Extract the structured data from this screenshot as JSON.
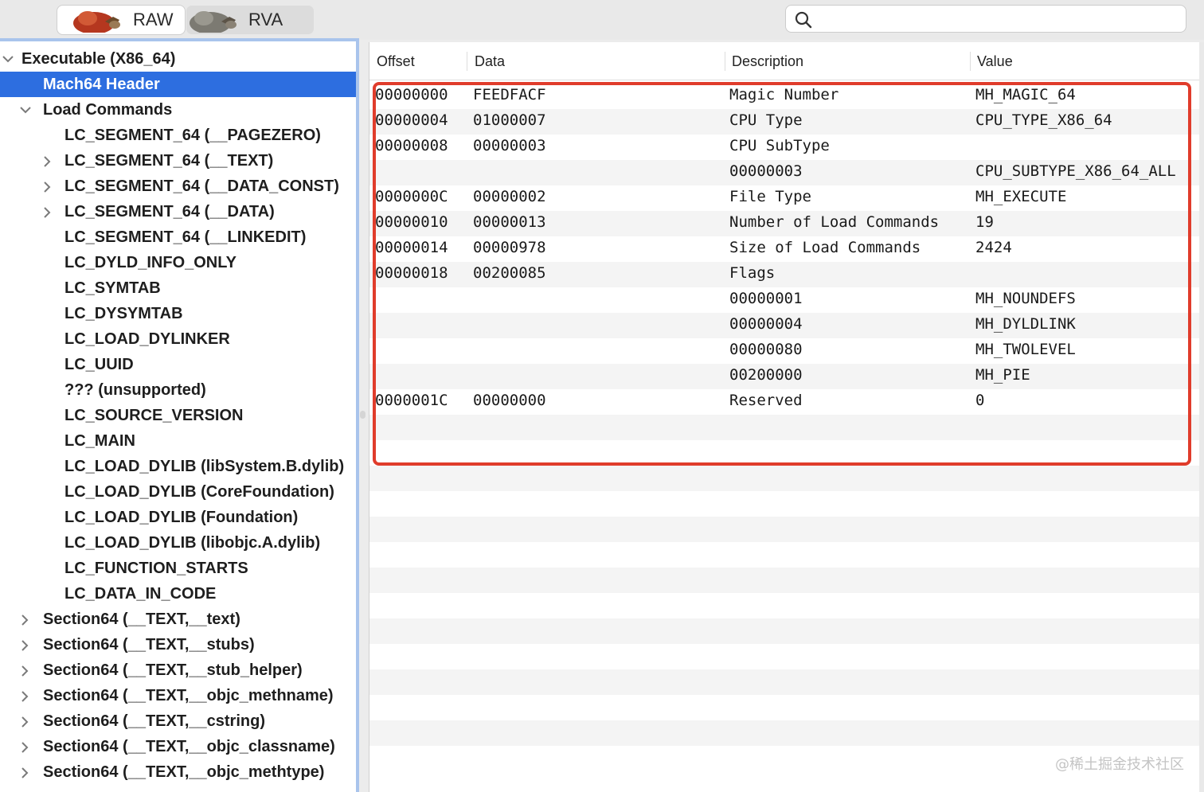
{
  "toolbar": {
    "raw_label": "RAW",
    "rva_label": "RVA",
    "search_placeholder": "",
    "icons": {
      "search": "magnifier-icon"
    }
  },
  "sidebar": {
    "items": [
      {
        "label": "Executable  (X86_64)",
        "level": 0,
        "chevron": "down",
        "selected": false
      },
      {
        "label": "Mach64 Header",
        "level": 1,
        "chevron": "none",
        "selected": true
      },
      {
        "label": "Load Commands",
        "level": 1,
        "chevron": "down",
        "selected": false
      },
      {
        "label": "LC_SEGMENT_64 (__PAGEZERO)",
        "level": 2,
        "chevron": "none",
        "selected": false
      },
      {
        "label": "LC_SEGMENT_64 (__TEXT)",
        "level": 2,
        "chevron": "right",
        "selected": false
      },
      {
        "label": "LC_SEGMENT_64 (__DATA_CONST)",
        "level": 2,
        "chevron": "right",
        "selected": false
      },
      {
        "label": "LC_SEGMENT_64 (__DATA)",
        "level": 2,
        "chevron": "right",
        "selected": false
      },
      {
        "label": "LC_SEGMENT_64 (__LINKEDIT)",
        "level": 2,
        "chevron": "none",
        "selected": false
      },
      {
        "label": "LC_DYLD_INFO_ONLY",
        "level": 2,
        "chevron": "none",
        "selected": false
      },
      {
        "label": "LC_SYMTAB",
        "level": 2,
        "chevron": "none",
        "selected": false
      },
      {
        "label": "LC_DYSYMTAB",
        "level": 2,
        "chevron": "none",
        "selected": false
      },
      {
        "label": "LC_LOAD_DYLINKER",
        "level": 2,
        "chevron": "none",
        "selected": false
      },
      {
        "label": "LC_UUID",
        "level": 2,
        "chevron": "none",
        "selected": false
      },
      {
        "label": "??? (unsupported)",
        "level": 2,
        "chevron": "none",
        "selected": false
      },
      {
        "label": "LC_SOURCE_VERSION",
        "level": 2,
        "chevron": "none",
        "selected": false
      },
      {
        "label": "LC_MAIN",
        "level": 2,
        "chevron": "none",
        "selected": false
      },
      {
        "label": "LC_LOAD_DYLIB (libSystem.B.dylib)",
        "level": 2,
        "chevron": "none",
        "selected": false
      },
      {
        "label": "LC_LOAD_DYLIB (CoreFoundation)",
        "level": 2,
        "chevron": "none",
        "selected": false
      },
      {
        "label": "LC_LOAD_DYLIB (Foundation)",
        "level": 2,
        "chevron": "none",
        "selected": false
      },
      {
        "label": "LC_LOAD_DYLIB (libobjc.A.dylib)",
        "level": 2,
        "chevron": "none",
        "selected": false
      },
      {
        "label": "LC_FUNCTION_STARTS",
        "level": 2,
        "chevron": "none",
        "selected": false
      },
      {
        "label": "LC_DATA_IN_CODE",
        "level": 2,
        "chevron": "none",
        "selected": false
      },
      {
        "label": "Section64 (__TEXT,__text)",
        "level": 1,
        "chevron": "right",
        "selected": false
      },
      {
        "label": "Section64 (__TEXT,__stubs)",
        "level": 1,
        "chevron": "right",
        "selected": false
      },
      {
        "label": "Section64 (__TEXT,__stub_helper)",
        "level": 1,
        "chevron": "right",
        "selected": false
      },
      {
        "label": "Section64 (__TEXT,__objc_methname)",
        "level": 1,
        "chevron": "right",
        "selected": false
      },
      {
        "label": "Section64 (__TEXT,__cstring)",
        "level": 1,
        "chevron": "right",
        "selected": false
      },
      {
        "label": "Section64 (__TEXT,__objc_classname)",
        "level": 1,
        "chevron": "right",
        "selected": false
      },
      {
        "label": "Section64 (__TEXT,__objc_methtype)",
        "level": 1,
        "chevron": "right",
        "selected": false
      }
    ]
  },
  "table": {
    "columns": [
      "Offset",
      "Data",
      "Description",
      "Value"
    ],
    "rows": [
      [
        "00000000",
        "FEEDFACF",
        "Magic Number",
        "MH_MAGIC_64"
      ],
      [
        "00000004",
        "01000007",
        "CPU Type",
        "CPU_TYPE_X86_64"
      ],
      [
        "00000008",
        "00000003",
        "CPU SubType",
        ""
      ],
      [
        "",
        "",
        "00000003",
        "CPU_SUBTYPE_X86_64_ALL"
      ],
      [
        "0000000C",
        "00000002",
        "File Type",
        "MH_EXECUTE"
      ],
      [
        "00000010",
        "00000013",
        "Number of Load Commands",
        "19"
      ],
      [
        "00000014",
        "00000978",
        "Size of Load Commands",
        "2424"
      ],
      [
        "00000018",
        "00200085",
        "Flags",
        ""
      ],
      [
        "",
        "",
        "00000001",
        "MH_NOUNDEFS"
      ],
      [
        "",
        "",
        "00000004",
        "MH_DYLDLINK"
      ],
      [
        "",
        "",
        "00000080",
        "MH_TWOLEVEL"
      ],
      [
        "",
        "",
        "00200000",
        "MH_PIE"
      ],
      [
        "0000001C",
        "00000000",
        "Reserved",
        "0"
      ]
    ],
    "empty_rows": 14
  },
  "watermark": "@稀土掘金技术社区",
  "colors": {
    "selection": "#2d6ee0",
    "highlight_box": "#e03c2b",
    "sidebar_focus_border": "#a9c4ec",
    "alt_row": "#f4f4f4"
  }
}
